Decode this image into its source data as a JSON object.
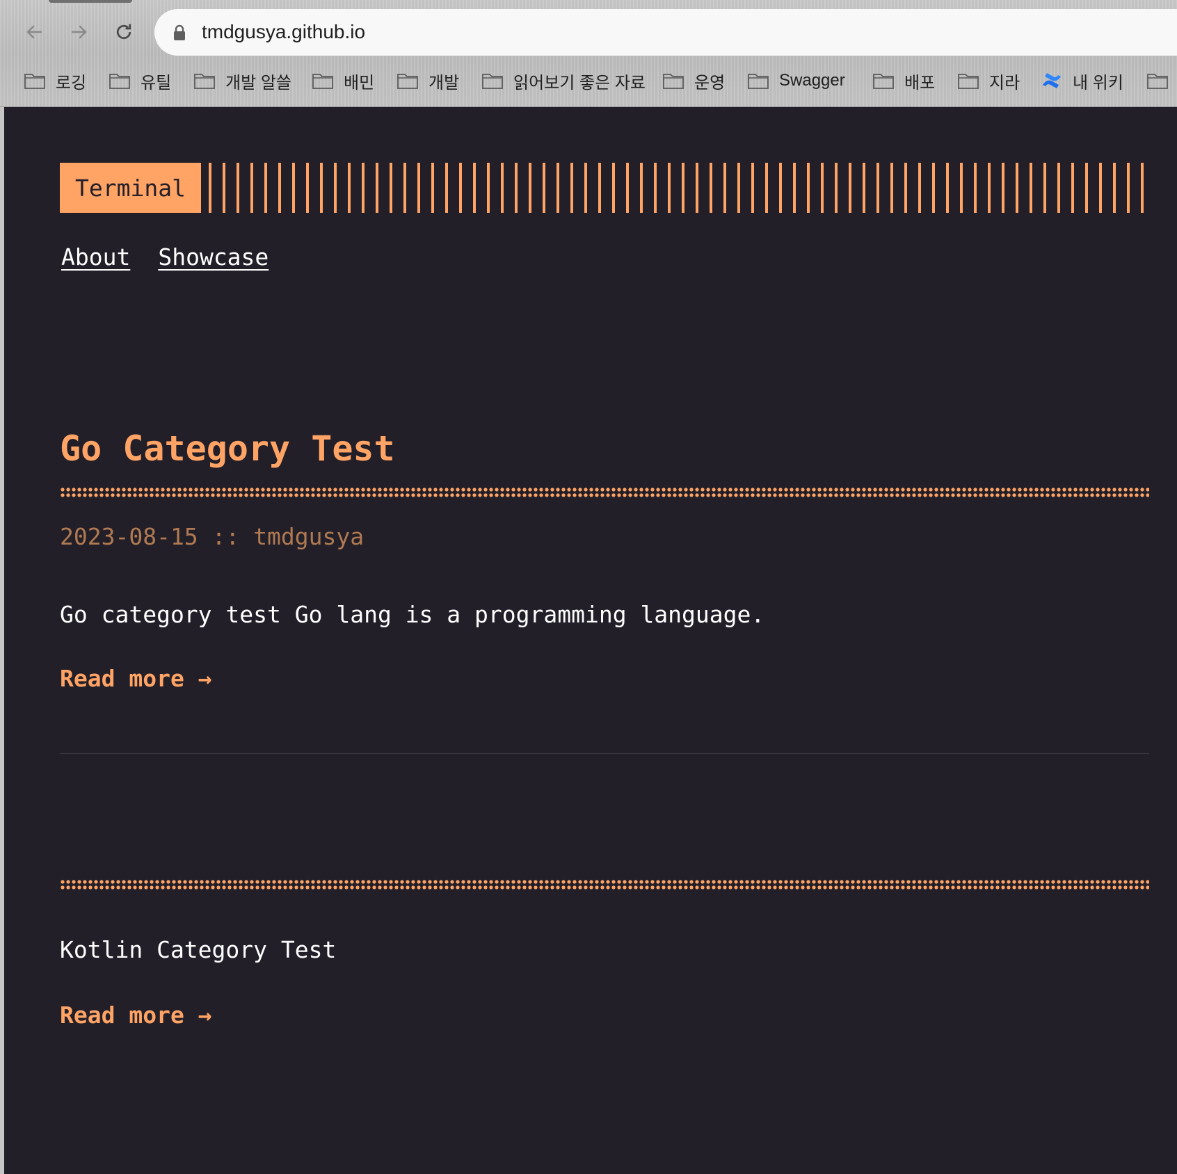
{
  "browser": {
    "url": "tmdgusya.github.io",
    "bookmarks": [
      {
        "label": "로깅",
        "icon": "folder-icon"
      },
      {
        "label": "유틸",
        "icon": "folder-icon"
      },
      {
        "label": "개발 알쓸",
        "icon": "folder-icon"
      },
      {
        "label": "배민",
        "icon": "folder-icon"
      },
      {
        "label": "개발",
        "icon": "folder-icon"
      },
      {
        "label": "읽어보기 좋은 자료",
        "icon": "folder-icon"
      },
      {
        "label": "운영",
        "icon": "folder-icon"
      },
      {
        "label": "Swagger",
        "icon": "folder-icon"
      },
      {
        "label": "배포",
        "icon": "folder-icon"
      },
      {
        "label": "지라",
        "icon": "folder-icon"
      },
      {
        "label": "내 위키",
        "icon": "confluence-icon"
      },
      {
        "label": "",
        "icon": "folder-icon"
      }
    ]
  },
  "site": {
    "logo": "Terminal",
    "menu": [
      {
        "label": "About"
      },
      {
        "label": "Showcase"
      }
    ]
  },
  "posts": [
    {
      "title": "Go Category Test",
      "date": "2023-08-15",
      "separator": "::",
      "author": "tmdgusya",
      "content": "Go category test Go lang is a programming language.",
      "read_more": "Read more →"
    },
    {
      "title": "",
      "content": "Kotlin Category Test",
      "read_more": "Read more →"
    }
  ],
  "colors": {
    "accent": "#ffa465",
    "background": "#221f29",
    "meta": "#b07a52",
    "text": "#ffffff"
  }
}
